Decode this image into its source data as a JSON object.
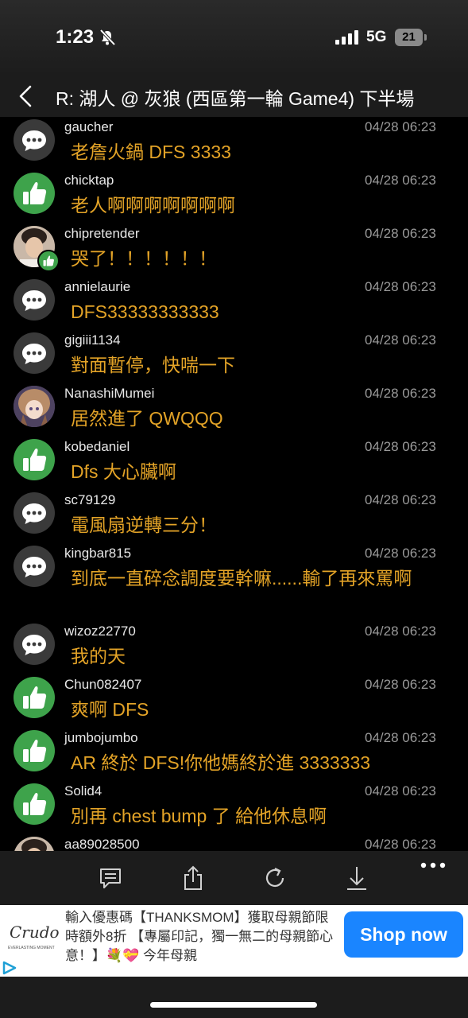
{
  "status_bar": {
    "time": "1:23",
    "network": "5G",
    "battery_level": "21"
  },
  "header": {
    "title": "R: 湖人 @ 灰狼 (西區第一輪 Game4) 下半場"
  },
  "comments": [
    {
      "user": "gaucher",
      "time": "04/28 06:23",
      "text": "老詹火鍋 DFS 3333",
      "avatar": "chat-bubble-icon"
    },
    {
      "user": "chicktap",
      "time": "04/28 06:23",
      "text": "老人啊啊啊啊啊啊啊",
      "avatar": "thumbs-up-icon"
    },
    {
      "user": "chipretender",
      "time": "04/28 06:23",
      "text": "哭了！！！！！！",
      "avatar": "user-photo-avatar"
    },
    {
      "user": "annielaurie",
      "time": "04/28 06:23",
      "text": "DFS33333333333",
      "avatar": "chat-bubble-icon"
    },
    {
      "user": "gigiii1134",
      "time": "04/28 06:23",
      "text": "對面暫停，快喘一下",
      "avatar": "chat-bubble-icon"
    },
    {
      "user": "NanashiMumei",
      "time": "04/28 06:23",
      "text": "居然進了 QWQQQ",
      "avatar": "anime-avatar"
    },
    {
      "user": "kobedaniel",
      "time": "04/28 06:23",
      "text": "Dfs 大心臟啊",
      "avatar": "thumbs-up-icon"
    },
    {
      "user": "sc79129",
      "time": "04/28 06:23",
      "text": "電風扇逆轉三分！",
      "avatar": "chat-bubble-icon"
    },
    {
      "user": "kingbar815",
      "time": "04/28 06:23",
      "text": "到底一直碎念調度要幹嘛......輸了再來罵啊",
      "avatar": "chat-bubble-icon"
    },
    {
      "user": "wizoz22770",
      "time": "04/28 06:23",
      "text": "我的天",
      "avatar": "chat-bubble-icon"
    },
    {
      "user": "Chun082407",
      "time": "04/28 06:23",
      "text": "爽啊 DFS",
      "avatar": "thumbs-up-icon"
    },
    {
      "user": "jumbojumbo",
      "time": "04/28 06:23",
      "text": "AR 終於 DFS!你他媽終於進 3333333",
      "avatar": "thumbs-up-icon"
    },
    {
      "user": "Solid4",
      "time": "04/28 06:23",
      "text": "別再 chest bump 了 給他休息啊",
      "avatar": "thumbs-up-icon"
    },
    {
      "user": "aa89028500",
      "time": "04/28 06:23",
      "text": "",
      "avatar": "user-photo-avatar"
    }
  ],
  "toolbar": {
    "buttons": [
      "comment-icon",
      "share-icon",
      "refresh-icon",
      "download-icon",
      "more-icon"
    ]
  },
  "ad": {
    "logo": "Crudo",
    "logo_sub": "EVERLASTING MOMENT",
    "text": "輸入優惠碼【THANKSMOM】獲取母親節限時額外8折 【專屬印記，獨一無二的母親節心意！】💐💝 今年母親",
    "cta": "Shop now"
  },
  "colors": {
    "comment_text": "#e3a327",
    "like_green": "#3ea34b",
    "cta_blue": "#1a85ff"
  }
}
